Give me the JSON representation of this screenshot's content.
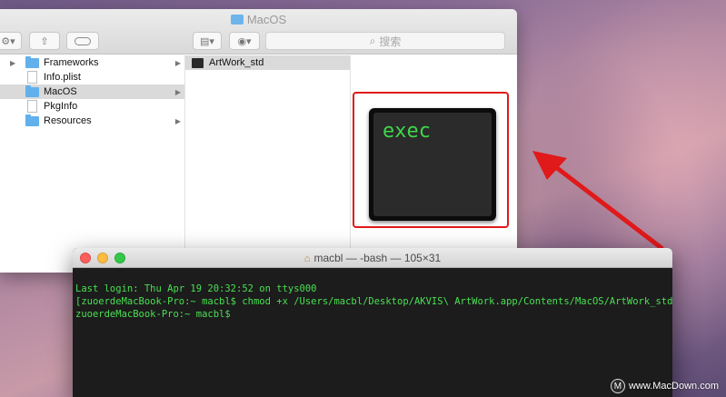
{
  "finder": {
    "title": "MacOS",
    "search_placeholder": "搜索",
    "column1": [
      {
        "label": "Frameworks",
        "type": "folder",
        "has_children": true
      },
      {
        "label": "Info.plist",
        "type": "file",
        "has_children": false
      },
      {
        "label": "MacOS",
        "type": "folder",
        "has_children": true,
        "selected": true
      },
      {
        "label": "PkgInfo",
        "type": "file",
        "has_children": false
      },
      {
        "label": "Resources",
        "type": "folder",
        "has_children": true
      }
    ],
    "column2": [
      {
        "label": "ArtWork_std",
        "type": "exec",
        "selected": true
      }
    ],
    "preview": {
      "icon_text": "exec"
    }
  },
  "terminal": {
    "title": "macbl — -bash — 105×31",
    "lines": [
      "Last login: Thu Apr 19 20:32:52 on ttys000",
      "[zuoerdeMacBook-Pro:~ macbl$ chmod +x /Users/macbl/Desktop/AKVIS\\ ArtWork.app/Contents/MacOS/ArtWork_std  ]",
      "zuoerdeMacBook-Pro:~ macbl$"
    ]
  },
  "watermark": {
    "text": "www.MacDown.com"
  },
  "colors": {
    "highlight": "#e0191a",
    "terminal_text": "#49e052",
    "folder": "#62b0ec"
  }
}
